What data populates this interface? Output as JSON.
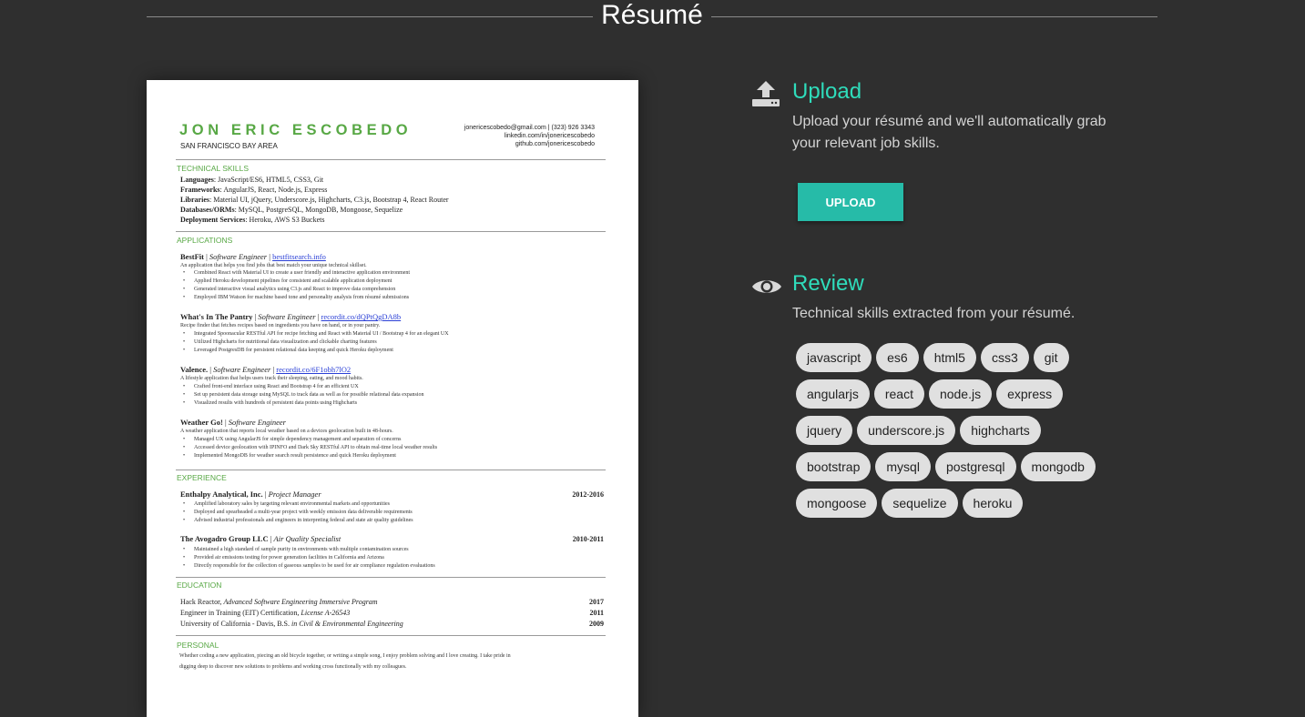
{
  "header": {
    "title": "Résumé"
  },
  "resume": {
    "name": "JON ERIC ESCOBEDO",
    "location": "SAN FRANCISCO BAY AREA",
    "contact": [
      "jonericescobedo@gmail.com | (323) 926 3343",
      "linkedin.com/in/jonericescobedo",
      "github.com/jonericescobedo"
    ],
    "sections": {
      "skills": "TECHNICAL SKILLS",
      "applications": "APPLICATIONS",
      "experience": "EXPERIENCE",
      "education": "EDUCATION",
      "personal": "PERSONAL"
    },
    "skills": [
      {
        "label": "Languages",
        "value": ": JavaScript/ES6, HTML5, CSS3, Git"
      },
      {
        "label": "Frameworks",
        "value": ": AngularJS, React, Node.js, Express"
      },
      {
        "label": "Libraries",
        "value": ": Material UI, jQuery, Underscore.js, Highcharts, C3.js, Bootstrap 4, React Router"
      },
      {
        "label": "Databases/ORMs",
        "value": ": MySQL, PostgreSQL, MongoDB, Mongoose, Sequelize"
      },
      {
        "label": "Deployment Services",
        "value": ": Heroku, AWS S3 Buckets"
      }
    ],
    "apps": [
      {
        "name": "BestFit",
        "role": "Software Engineer",
        "link": "bestfitsearch.info",
        "summary": "An application that helps you find jobs that best match your unique technical skillset.",
        "bullets": [
          "Combined React with Material UI to create a user friendly and interactive application environment",
          "Applied Heroku development pipelines for consistent and scalable application deployment",
          "Generated interactive visual analytics using C3.js and React to improve data comprehension",
          "Employed IBM Watson for machine based tone and personality analysis from résumé submissions"
        ]
      },
      {
        "name": "What's In The Pantry",
        "role": "Software Engineer",
        "link": "recordit.co/dQPtQgDA8b",
        "summary": "Recipe finder that fetches recipes based on ingredients you have on hand, or in your pantry.",
        "bullets": [
          "Integrated Spoonacular RESTful API for recipe fetching and React with Material UI / Bootstrap 4 for an elegant UX",
          "Utilized Highcharts for nutritional data visualization and clickable charting features",
          "Leveraged PostgresDB for persistent relational data keeping and quick Heroku deployment"
        ]
      },
      {
        "name": "Valence.",
        "role": "Software Engineer",
        "link": "recordit.co/6F1obh7lO2",
        "summary": "A lifestyle application that helps users track their sleeping, eating, and mood habits.",
        "bullets": [
          "Crafted front-end interface using React and Bootstrap 4 for an efficient UX",
          "Set up persistent data storage using MySQL to track data as well as for possible relational data expansion",
          "Visualized results with hundreds of persistent data points using Highcharts"
        ]
      },
      {
        "name": "Weather Go!",
        "role": "Software Engineer",
        "link": "",
        "summary": "A weather application that reports local weather based on a devices geolocation built in 48-hours.",
        "bullets": [
          "Managed UX using AngularJS for simple dependency management and separation of concerns",
          "Accessed device geolocation with IPINFO and Dark Sky RESTful API to obtain real-time local weather results",
          "Implemented MongoDB for weather search result persistence and quick Heroku deployment"
        ]
      }
    ],
    "jobs": [
      {
        "company": "Enthalpy Analytical, Inc.",
        "role": "Project Manager",
        "years": "2012-2016",
        "bullets": [
          "Amplified laboratory sales by targeting relevant environmental markets and opportunities",
          "Deployed and spearheaded a multi-year project with weekly emission data deliverable requirements",
          "Advised industrial professionals and engineers in interpreting federal and state air quality guidelines"
        ]
      },
      {
        "company": "The Avogadro Group LLC",
        "role": "Air Quality Specialist",
        "years": "2010-2011",
        "bullets": [
          "Maintained a high standard of sample purity in environments with multiple contamination sources",
          "Provided air emissions testing for power generation facilities in California and Arizona",
          "Directly responsible for the collection of gaseous samples to be used for air compliance regulation evaluations"
        ]
      }
    ],
    "education": [
      {
        "school": "Hack Reactor, ",
        "detail": "Advanced Software Engineering Immersive Program",
        "year": "2017"
      },
      {
        "school": "Engineer in Training (EIT) Certification, ",
        "detail": "License A-26543",
        "year": "2011"
      },
      {
        "school": "University of California - Davis, B.S. ",
        "detail": "in Civil & Environmental Engineering",
        "year": "2009"
      }
    ],
    "personal": [
      "Whether coding a new application, piecing an old bicycle together, or writing a simple song, I enjoy problem solving and I love creating. I take pride in",
      "digging deep to discover new solutions to problems and working cross functionally with my colleagues."
    ]
  },
  "upload": {
    "title": "Upload",
    "desc1": "Upload your résumé and we'll automatically grab",
    "desc2": "your relevant job skills.",
    "button": "UPLOAD",
    "icon": "upload-icon"
  },
  "review": {
    "title": "Review",
    "desc": "Technical skills extracted from your résumé.",
    "icon": "eye-icon",
    "skills": [
      "javascript",
      "es6",
      "html5",
      "css3",
      "git",
      "angularjs",
      "react",
      "node.js",
      "express",
      "jquery",
      "underscore.js",
      "highcharts",
      "bootstrap",
      "mysql",
      "postgresql",
      "mongodb",
      "mongoose",
      "sequelize",
      "heroku"
    ]
  },
  "colors": {
    "background": "#2f2f2f",
    "accent": "#2fdcbb",
    "button": "#26bba8",
    "resume_green": "#58a845",
    "chip": "#e0e0e0"
  }
}
